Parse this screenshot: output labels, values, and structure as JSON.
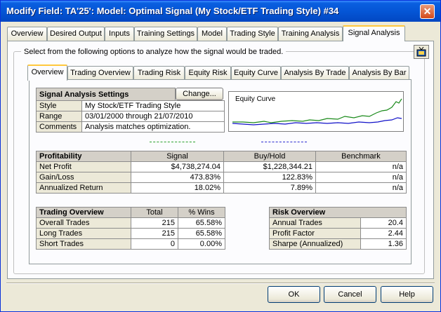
{
  "window": {
    "title": "Modify Field: TA'25': Model: Optimal Signal (My Stock/ETF Trading Style) #34"
  },
  "tabs": [
    {
      "label": "Overview"
    },
    {
      "label": "Desired Output"
    },
    {
      "label": "Inputs"
    },
    {
      "label": "Training Settings"
    },
    {
      "label": "Model"
    },
    {
      "label": "Trading Style"
    },
    {
      "label": "Training Analysis"
    },
    {
      "label": "Signal Analysis"
    }
  ],
  "group_label": "Select from the following options to analyze how the signal would be traded.",
  "subtabs": [
    {
      "label": "Overview"
    },
    {
      "label": "Trading Overview"
    },
    {
      "label": "Trading Risk"
    },
    {
      "label": "Equity Risk"
    },
    {
      "label": "Equity Curve"
    },
    {
      "label": "Analysis By Trade"
    },
    {
      "label": "Analysis By Bar"
    }
  ],
  "settings": {
    "header": "Signal Analysis Settings",
    "change_label": "Change...",
    "rows": [
      {
        "label": "Style",
        "value": "My Stock/ETF Trading Style"
      },
      {
        "label": "Range",
        "value": "03/01/2000 through 21/07/2010"
      },
      {
        "label": "Comments",
        "value": "Analysis matches optimization."
      }
    ]
  },
  "equity_chart": {
    "title": "Equity Curve",
    "colors": {
      "signal": "#1a8a1a",
      "buyhold": "#1010c8",
      "legend_signal": "#2aa02a",
      "legend_buyhold": "#2a2ad0"
    }
  },
  "profitability": {
    "columns": [
      "Profitability",
      "Signal",
      "Buy/Hold",
      "Benchmark"
    ],
    "rows": [
      {
        "label": "Net Profit",
        "signal": "$4,738,274.04",
        "buyhold": "$1,228,344.21",
        "benchmark": "n/a"
      },
      {
        "label": "Gain/Loss",
        "signal": "473.83%",
        "buyhold": "122.83%",
        "benchmark": "n/a"
      },
      {
        "label": "Annualized Return",
        "signal": "18.02%",
        "buyhold": "7.89%",
        "benchmark": "n/a"
      }
    ]
  },
  "trading_overview": {
    "columns": [
      "Trading Overview",
      "Total",
      "% Wins"
    ],
    "rows": [
      {
        "label": "Overall Trades",
        "total": "215",
        "wins": "65.58%"
      },
      {
        "label": "Long Trades",
        "total": "215",
        "wins": "65.58%"
      },
      {
        "label": "Short Trades",
        "total": "0",
        "wins": "0.00%"
      }
    ]
  },
  "risk_overview": {
    "header": "Risk Overview",
    "rows": [
      {
        "label": "Annual Trades",
        "value": "20.4"
      },
      {
        "label": "Profit Factor",
        "value": "2.44"
      },
      {
        "label": "Sharpe (Annualized)",
        "value": "1.36"
      }
    ]
  },
  "buttons": {
    "ok": "OK",
    "cancel": "Cancel",
    "help": "Help"
  }
}
